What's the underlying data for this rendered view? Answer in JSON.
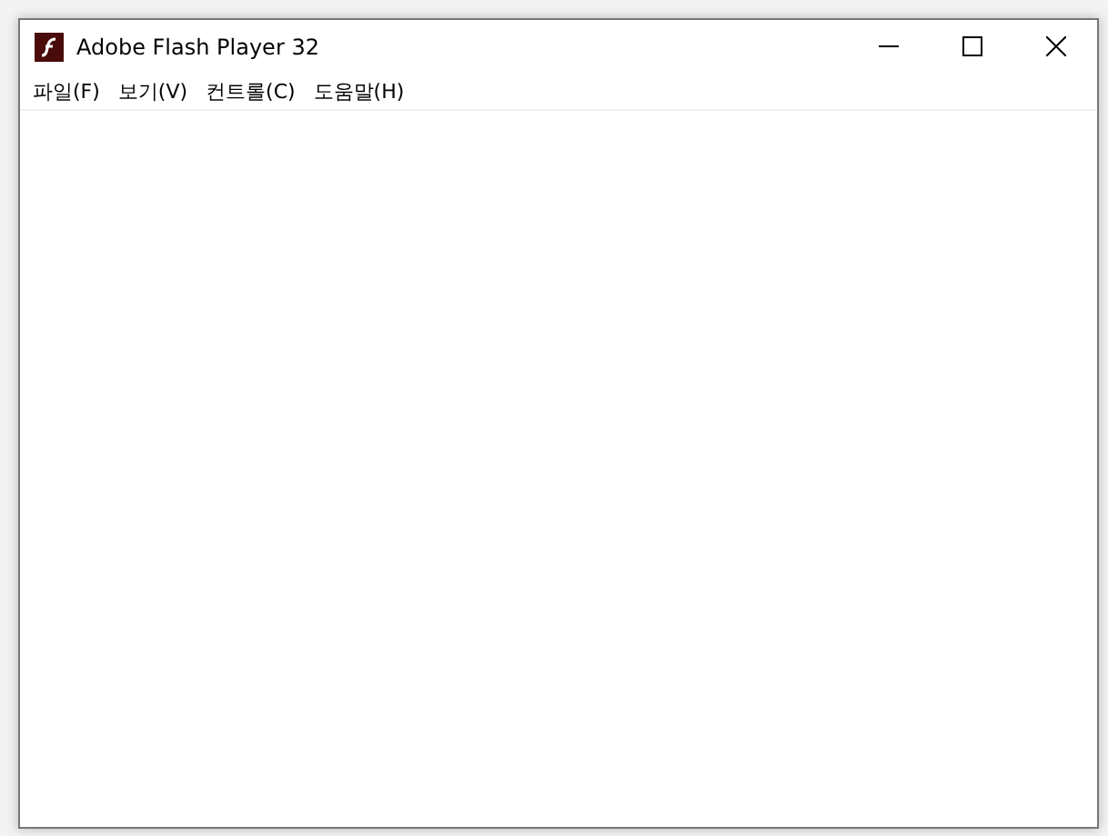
{
  "window": {
    "title": "Adobe Flash Player 32"
  },
  "menu": [
    {
      "label": "파일(F)"
    },
    {
      "label": "보기(V)"
    },
    {
      "label": "컨트롤(C)"
    },
    {
      "label": "도움말(H)"
    }
  ]
}
